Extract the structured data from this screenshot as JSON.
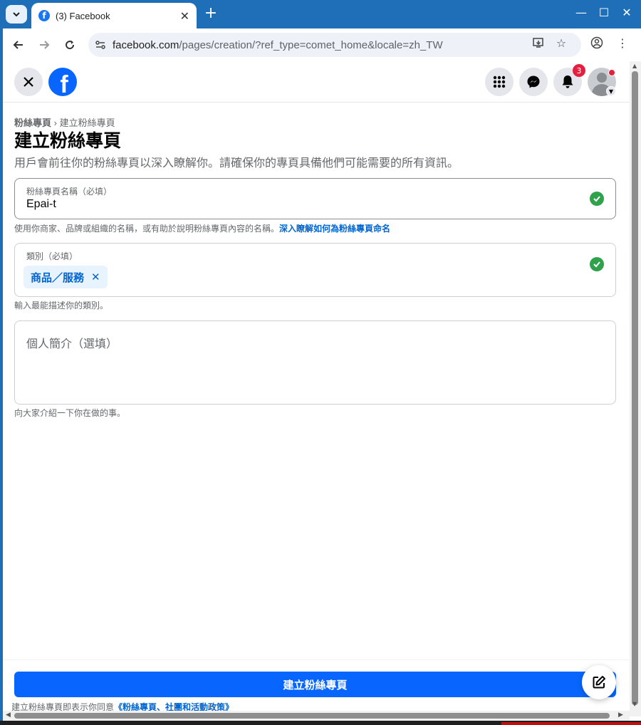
{
  "browser": {
    "tab_title": "(3) Facebook",
    "favicon_letter": "f",
    "url_domain": "facebook.com",
    "url_path": "/pages/creation/?ref_type=comet_home&locale=zh_TW"
  },
  "header": {
    "logo_letter": "f",
    "notifications_count": "3"
  },
  "content": {
    "breadcrumb_parent": "粉絲專頁",
    "breadcrumb_separator": " › ",
    "breadcrumb_current": "建立粉絲專頁",
    "title": "建立粉絲專頁",
    "subtitle": "用戶會前往你的粉絲專頁以深入瞭解你。請確保你的專頁具備他們可能需要的所有資訊。"
  },
  "name_field": {
    "label": "粉絲專頁名稱（必填）",
    "value": "Epai-t",
    "helper_text": "使用你商家、品牌或組織的名稱，或有助於說明粉絲專頁內容的名稱。",
    "helper_link": "深入瞭解如何為粉絲專頁命名"
  },
  "category_field": {
    "label": "類別（必填）",
    "chip_label": "商品／服務",
    "chip_remove": "✕",
    "helper_text": "輸入最能描述你的類別。"
  },
  "bio_field": {
    "placeholder": "個人簡介（選填）",
    "helper_text": "向大家介紹一下你在做的事。"
  },
  "footer": {
    "create_button": "建立粉絲專頁",
    "terms_prefix": "建立粉絲專頁即表示你同意",
    "terms_link": "《粉絲專頁、社團和活動政策》"
  },
  "colors": {
    "facebook_blue": "#0866ff",
    "link_blue": "#0064d1",
    "success_green": "#31a24c",
    "badge_red": "#e41e3f"
  }
}
